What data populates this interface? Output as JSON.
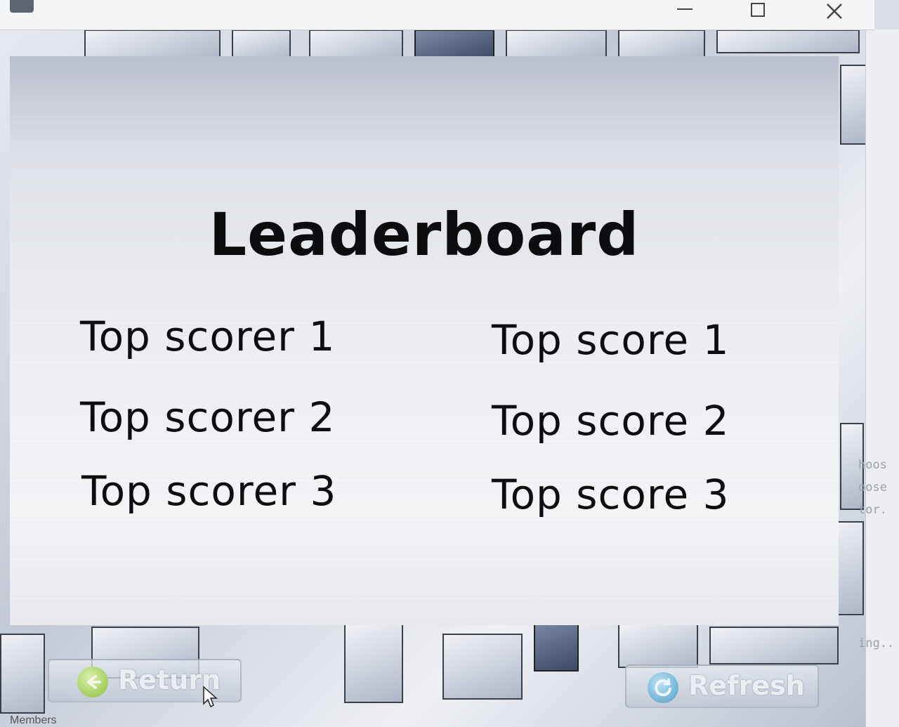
{
  "window": {
    "minimize_icon": "minimize-icon",
    "maximize_icon": "maximize-icon",
    "close_icon": "close-icon"
  },
  "leaderboard": {
    "title": "Leaderboard",
    "rows": [
      {
        "scorer": "Top scorer 1",
        "score": "Top score 1"
      },
      {
        "scorer": "Top scorer 2",
        "score": "Top score 2"
      },
      {
        "scorer": "Top scorer 3",
        "score": "Top score 3"
      }
    ]
  },
  "buttons": {
    "return_label": "Return",
    "return_icon": "back-arrow-icon",
    "refresh_label": "Refresh",
    "refresh_icon": "refresh-icon"
  },
  "background_window": {
    "side_texts": [
      "hoos",
      "oose",
      "tor.",
      "ing.."
    ],
    "footer_text": "Members"
  },
  "colors": {
    "title_text": "#0c0c0e",
    "return_icon": "#8dbf3f",
    "refresh_icon": "#4c9cc8"
  }
}
